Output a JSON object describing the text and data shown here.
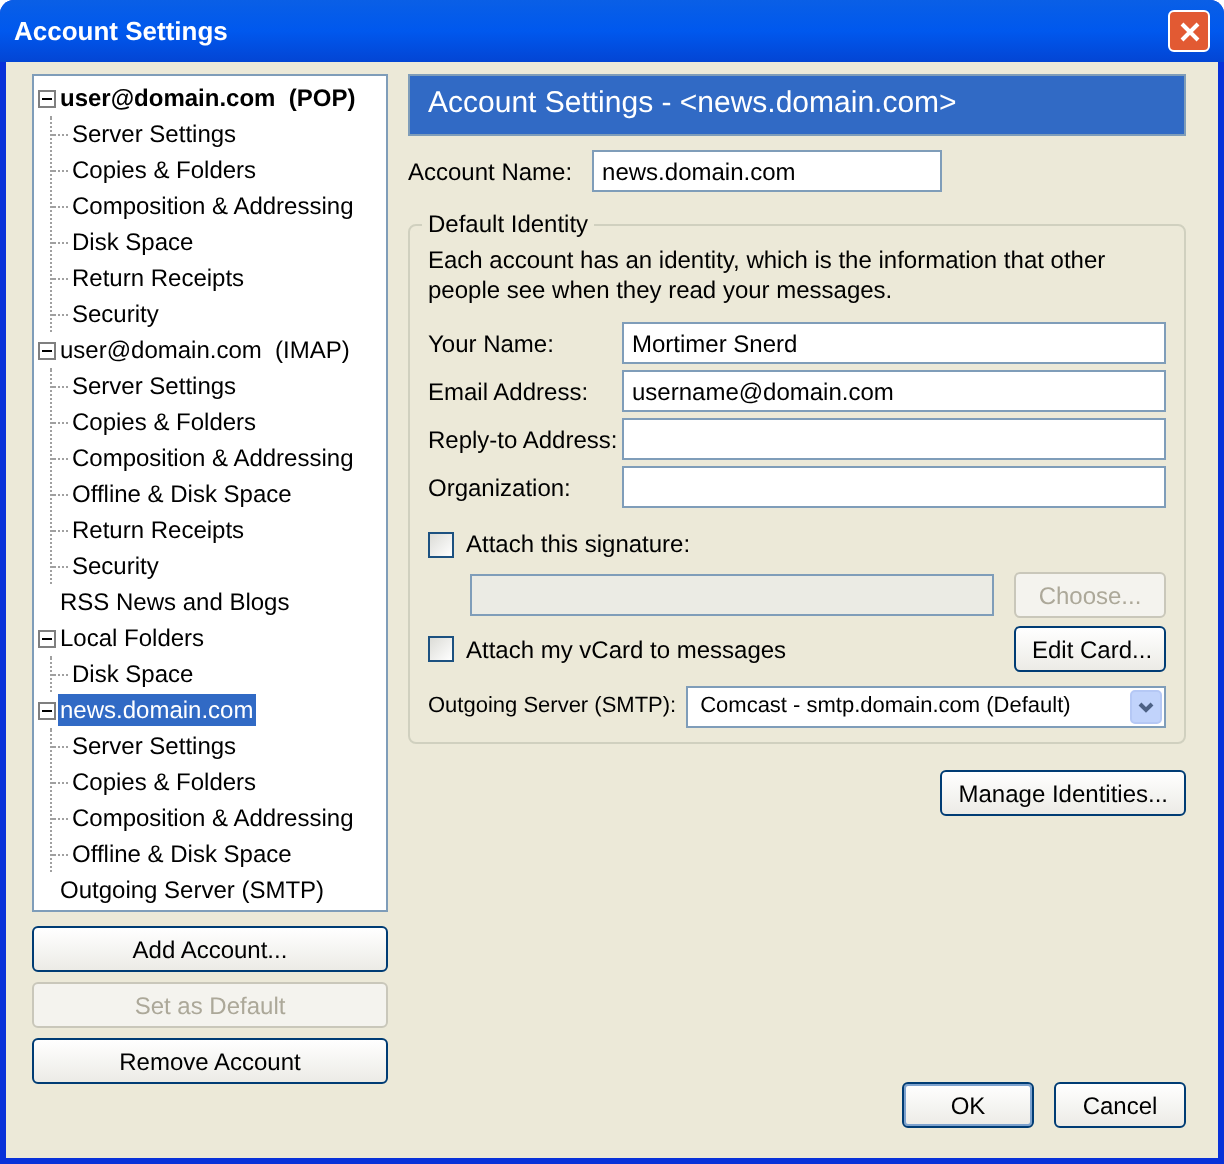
{
  "window": {
    "title": "Account Settings"
  },
  "tree": [
    {
      "label": "user@domain.com  (POP)",
      "bold": true,
      "expanded": true,
      "selected": false,
      "children": [
        {
          "label": "Server Settings",
          "selected": false
        },
        {
          "label": "Copies & Folders",
          "selected": false
        },
        {
          "label": "Composition & Addressing",
          "selected": false
        },
        {
          "label": "Disk Space",
          "selected": false
        },
        {
          "label": "Return Receipts",
          "selected": false
        },
        {
          "label": "Security",
          "selected": false
        }
      ]
    },
    {
      "label": "user@domain.com  (IMAP)",
      "bold": false,
      "expanded": true,
      "selected": false,
      "children": [
        {
          "label": "Server Settings",
          "selected": false
        },
        {
          "label": "Copies & Folders",
          "selected": false
        },
        {
          "label": "Composition & Addressing",
          "selected": false
        },
        {
          "label": "Offline & Disk Space",
          "selected": false
        },
        {
          "label": "Return Receipts",
          "selected": false
        },
        {
          "label": "Security",
          "selected": false
        }
      ]
    },
    {
      "label": "RSS News and Blogs",
      "bold": false,
      "selected": false
    },
    {
      "label": "Local Folders",
      "bold": false,
      "expanded": true,
      "selected": false,
      "children": [
        {
          "label": "Disk Space",
          "selected": false
        }
      ]
    },
    {
      "label": "news.domain.com",
      "bold": false,
      "expanded": true,
      "selected": true,
      "children": [
        {
          "label": "Server Settings",
          "selected": false
        },
        {
          "label": "Copies & Folders",
          "selected": false
        },
        {
          "label": "Composition & Addressing",
          "selected": false
        },
        {
          "label": "Offline & Disk Space",
          "selected": false
        }
      ]
    },
    {
      "label": "Outgoing Server (SMTP)",
      "bold": false,
      "selected": false
    }
  ],
  "account_buttons": [
    {
      "label": "Add Account...",
      "disabled": false
    },
    {
      "label": "Set as Default",
      "disabled": true
    },
    {
      "label": "Remove Account",
      "disabled": false
    }
  ],
  "panel": {
    "header": "Account Settings - <news.domain.com>",
    "account_name": {
      "label": "Account Name:",
      "value": "news.domain.com"
    },
    "identity": {
      "legend": "Default Identity",
      "description": "Each account has an identity, which is the information that other people see when they read your messages.",
      "fields": [
        {
          "label": "Your Name:",
          "value": "Mortimer Snerd"
        },
        {
          "label": "Email Address:",
          "value": "username@domain.com"
        },
        {
          "label": "Reply-to Address:"
        },
        {
          "label": "Organization:"
        }
      ],
      "signature": {
        "label": "Attach this signature:",
        "checked": false,
        "field_disabled": true,
        "button": {
          "label": "Choose...",
          "disabled": true
        }
      },
      "vcard": {
        "label": "Attach my vCard to messages",
        "checked": false,
        "button": {
          "label": "Edit Card...",
          "disabled": false
        }
      },
      "smtp": {
        "label": "Outgoing Server (SMTP):",
        "value": "Comcast - smtp.domain.com (Default)"
      }
    },
    "manage_button": "Manage Identities..."
  },
  "dialog_buttons": [
    "OK",
    "Cancel"
  ]
}
